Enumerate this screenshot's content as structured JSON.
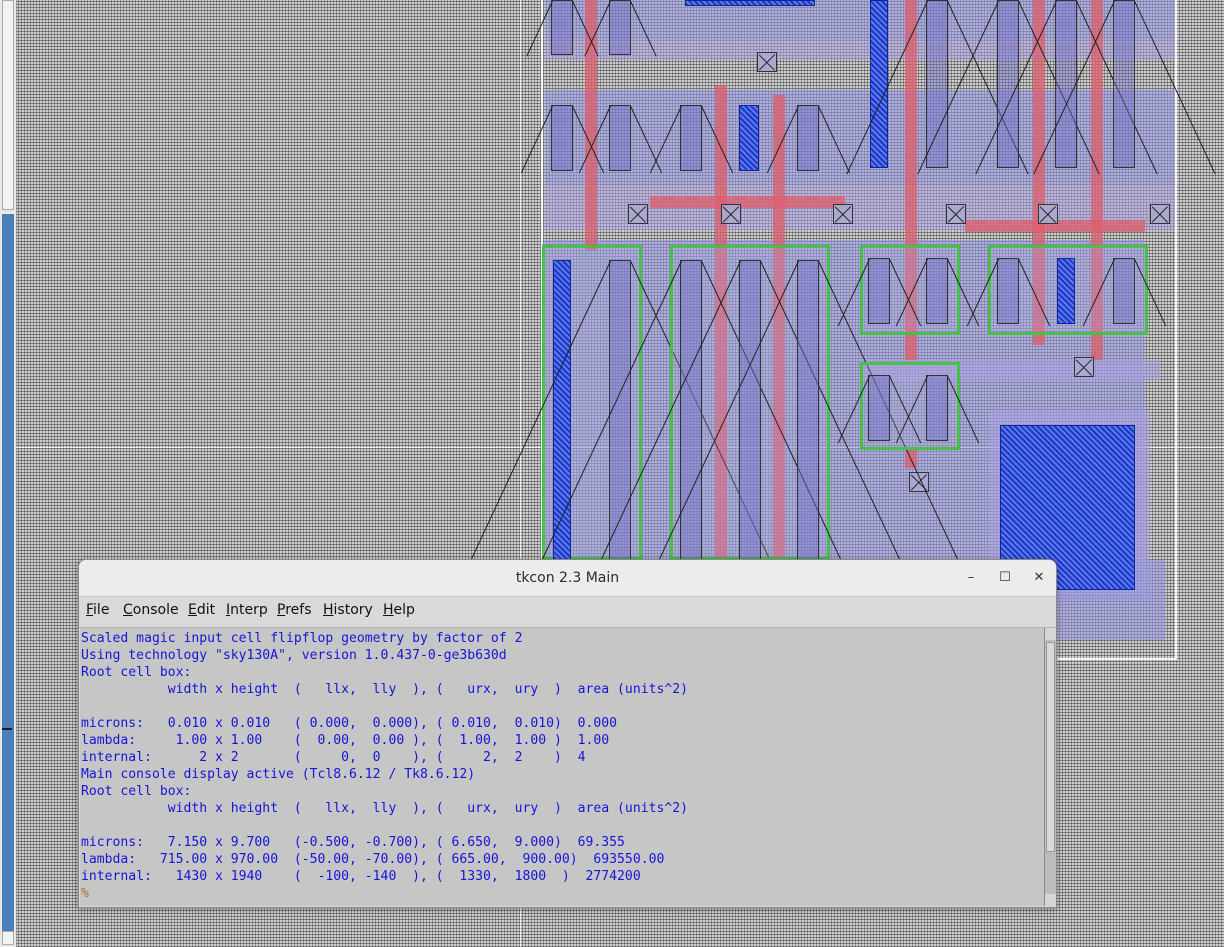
{
  "window": {
    "title": "tkcon 2.3 Main",
    "minimize": "–",
    "maximize": "☐",
    "close": "✕"
  },
  "menu": [
    {
      "accel": "F",
      "rest": "ile"
    },
    {
      "accel": "C",
      "rest": "onsole"
    },
    {
      "accel": "E",
      "rest": "dit"
    },
    {
      "accel": "I",
      "rest": "nterp"
    },
    {
      "accel": "P",
      "rest": "refs"
    },
    {
      "accel": "H",
      "rest": "istory"
    },
    {
      "accel": "H",
      "rest": "elp"
    }
  ],
  "console": {
    "lines": [
      "Scaled magic input cell flipflop geometry by factor of 2",
      "Using technology \"sky130A\", version 1.0.437-0-ge3b630d",
      "Root cell box:",
      "           width x height  (   llx,  lly  ), (   urx,  ury  )  area (units^2)",
      "",
      "microns:   0.010 x 0.010   ( 0.000,  0.000), ( 0.010,  0.010)  0.000",
      "lambda:     1.00 x 1.00    (  0.00,  0.00 ), (  1.00,  1.00 )  1.00",
      "internal:      2 x 2       (     0,  0    ), (     2,  2    )  4",
      "Main console display active (Tcl8.6.12 / Tk8.6.12)",
      "Root cell box:",
      "           width x height  (   llx,  lly  ), (   urx,  ury  )  area (units^2)",
      "",
      "microns:   7.150 x 9.700   (-0.500, -0.700), ( 6.650,  9.000)  69.355",
      "lambda:   715.00 x 970.00  (-50.00, -70.00), ( 665.00,  900.00)  693550.00",
      "internal:   1430 x 1940    (  -100, -140  ), (  1330,  1800  )  2774200"
    ],
    "prompt": "%"
  },
  "colors": {
    "console_text": "#1515d8",
    "console_bg": "#c6c6c6",
    "prompt": "#b86a1a",
    "poly": "#dc5f6e",
    "ndiff": "#1b38c8",
    "diff_outline": "#46c046"
  }
}
